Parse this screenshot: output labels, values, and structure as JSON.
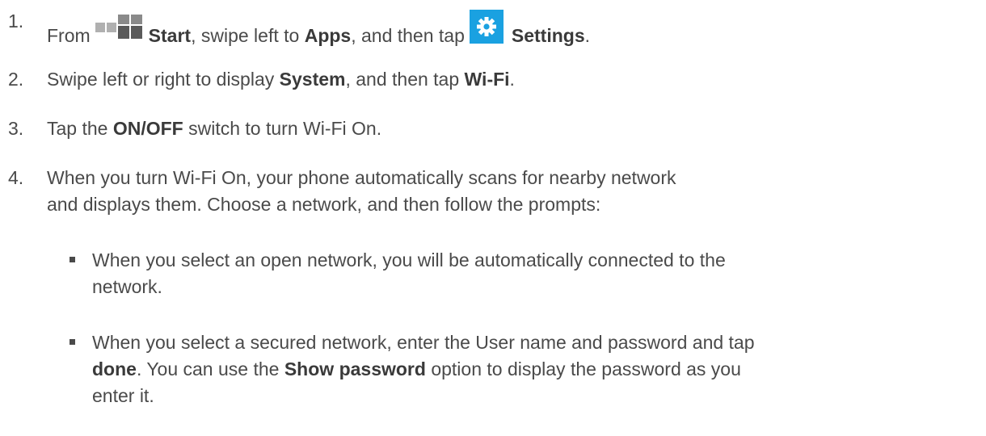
{
  "steps": [
    {
      "number": "1.",
      "parts": {
        "a": "From",
        "start": "Start",
        "b": ", swipe left to ",
        "apps": "Apps",
        "c": ", and then tap",
        "settings": "Settings",
        "d": "."
      }
    },
    {
      "number": "2.",
      "parts": {
        "a": "Swipe left or right to display ",
        "system": "System",
        "b": ", and then tap ",
        "wifi": "Wi-Fi",
        "c": "."
      }
    },
    {
      "number": "3.",
      "parts": {
        "a": "Tap the ",
        "onoff": "ON/OFF",
        "b": " switch to turn Wi-Fi On."
      }
    },
    {
      "number": "4.",
      "text": "When you turn Wi-Fi On, your phone automatically scans for nearby network and displays them. Choose a network, and then follow the prompts:"
    }
  ],
  "bullets": [
    {
      "text": "When you select an open network, you will be automatically connected to the network."
    },
    {
      "a": "When you select a secured network, enter the User name and password and tap ",
      "done": "done",
      "b": ". You can use the ",
      "show_password": "Show password",
      "c": " option to display the password as you enter it."
    }
  ],
  "icons": {
    "start": "windows-start-icon",
    "settings": "settings-gear-icon",
    "settings_color": "#1aa1e1"
  }
}
